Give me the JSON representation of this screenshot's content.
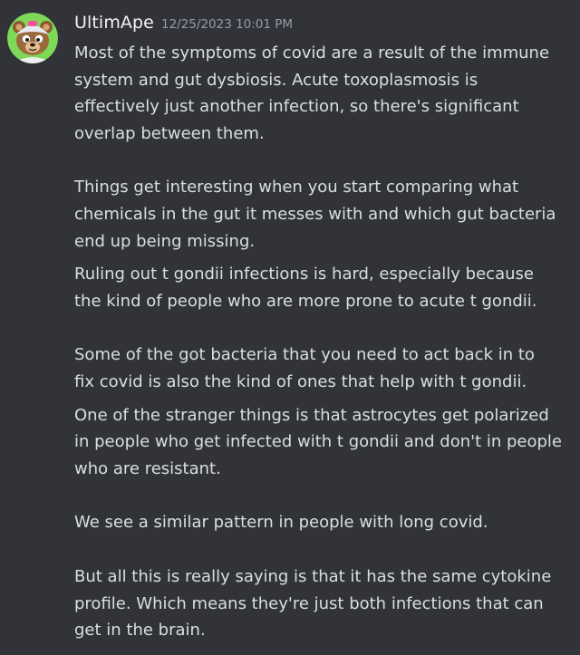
{
  "message": {
    "username": "UltimApe",
    "timestamp": "12/25/2023 10:01 PM",
    "avatar_icon": "bear-mascot-icon",
    "paragraphs": [
      "Most of the symptoms of covid are a result of the immune\nsystem and gut dysbiosis. Acute toxoplasmosis is\neffectively just another infection, so there's significant\noverlap between them.",
      "Things get interesting when you start comparing what\nchemicals in the gut it messes with and which gut bacteria\nend up being missing.",
      "Ruling out t gondii infections is hard, especially because\nthe kind of people who are more prone to acute t gondii.",
      "Some of the got bacteria that you need to act back in to\nfix covid is also the kind of ones that help with t gondii.",
      "One of the stranger things is that astrocytes get polarized\nin people who get infected with t gondii and don't in people\nwho are resistant.",
      "We see a similar pattern in people with long covid.",
      "But all this is really saying is that it has the same cytokine\nprofile. Which means they're just both infections that can\nget in the brain."
    ]
  },
  "colors": {
    "background": "#313338",
    "text": "#dbdee1",
    "username": "#f2f3f5",
    "timestamp": "#949ba4"
  }
}
